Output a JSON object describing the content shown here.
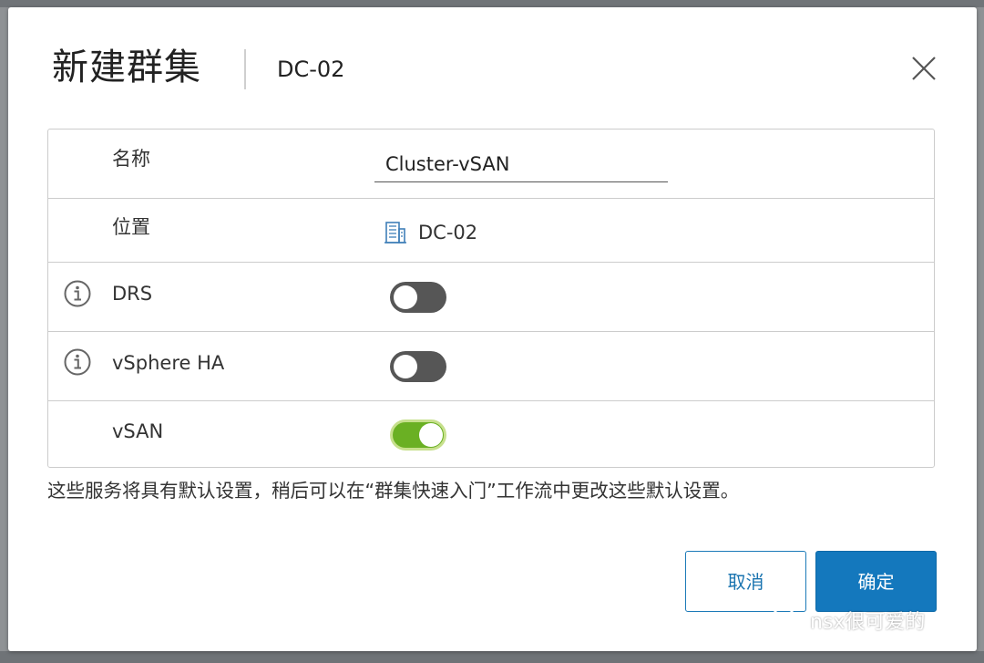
{
  "dialog": {
    "title": "新建群集",
    "subtitle": "DC-02",
    "close_icon": "close-icon"
  },
  "form": {
    "name": {
      "label": "名称",
      "value": "Cluster-vSAN"
    },
    "location": {
      "label": "位置",
      "value": "DC-02",
      "icon": "datacenter-building-icon"
    },
    "drs": {
      "label": "DRS",
      "enabled": false,
      "icon": "info-icon"
    },
    "ha": {
      "label": "vSphere HA",
      "enabled": false,
      "icon": "info-icon"
    },
    "vsan": {
      "label": "vSAN",
      "enabled": true
    }
  },
  "hint": "这些服务将具有默认设置，稍后可以在“群集快速入门”工作流中更改这些默认设置。",
  "buttons": {
    "cancel": "取消",
    "ok": "确定"
  },
  "watermark": {
    "text": "nsx很可爱的",
    "icon": "wechat-icon"
  },
  "colors": {
    "primary": "#1478bd",
    "toggle_on": "#6ab023",
    "toggle_off": "#565656",
    "border": "#cccccc"
  }
}
